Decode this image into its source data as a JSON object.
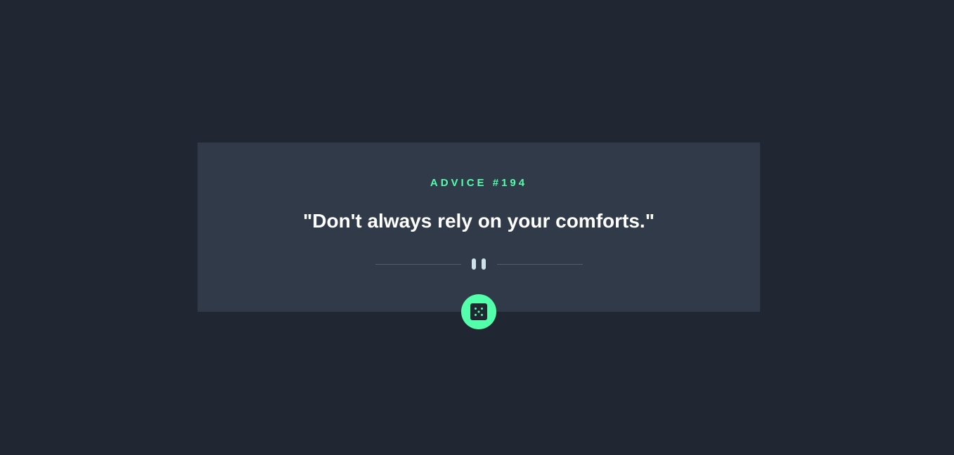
{
  "advice": {
    "heading": "ADVICE #194",
    "quote": "\"Don't always rely on your comforts.\""
  },
  "divider": {
    "icon": "pause-icon"
  },
  "dice_button": {
    "icon": "dice-icon"
  },
  "colors": {
    "background": "#202632",
    "card": "#313a49",
    "accent": "#53ffaa",
    "text": "#ffffff",
    "divider_line": "#4f5d74"
  }
}
